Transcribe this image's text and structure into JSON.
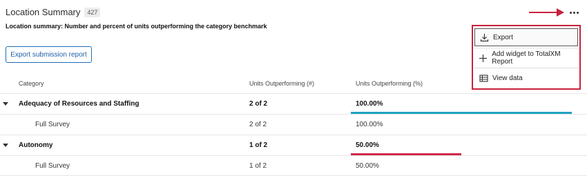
{
  "header": {
    "title": "Location Summary",
    "count": "427"
  },
  "subtitle": "Location summary: Number and percent of units outperforming the category benchmark",
  "export_report_label": "Export submission report",
  "table": {
    "columns": [
      "Category",
      "Units Outperforming (#)",
      "Units Outperforming (%)"
    ],
    "rows": [
      {
        "category": "Adequacy of Resources and Staffing",
        "count": "2 of 2",
        "percent": "100.00%",
        "percent_value": 1.0,
        "bar_color": "#1ea2bf",
        "type": "group"
      },
      {
        "category": "Full Survey",
        "count": "2 of 2",
        "percent": "100.00%",
        "type": "child"
      },
      {
        "category": "Autonomy",
        "count": "1 of 2",
        "percent": "50.00%",
        "percent_value": 0.5,
        "bar_color": "#d0294a",
        "type": "group"
      },
      {
        "category": "Full Survey",
        "count": "1 of 2",
        "percent": "50.00%",
        "type": "child"
      }
    ]
  },
  "menu": {
    "items": [
      {
        "label": "Export",
        "icon": "download-icon"
      },
      {
        "label": "Add widget to TotalXM Report",
        "icon": "plus-icon"
      },
      {
        "label": "View data",
        "icon": "table-icon"
      }
    ]
  },
  "colors": {
    "highlight": "#c8213a",
    "accent_blue": "#1f6fb5",
    "teal_bar": "#1ea2bf",
    "red_bar": "#d0294a"
  }
}
